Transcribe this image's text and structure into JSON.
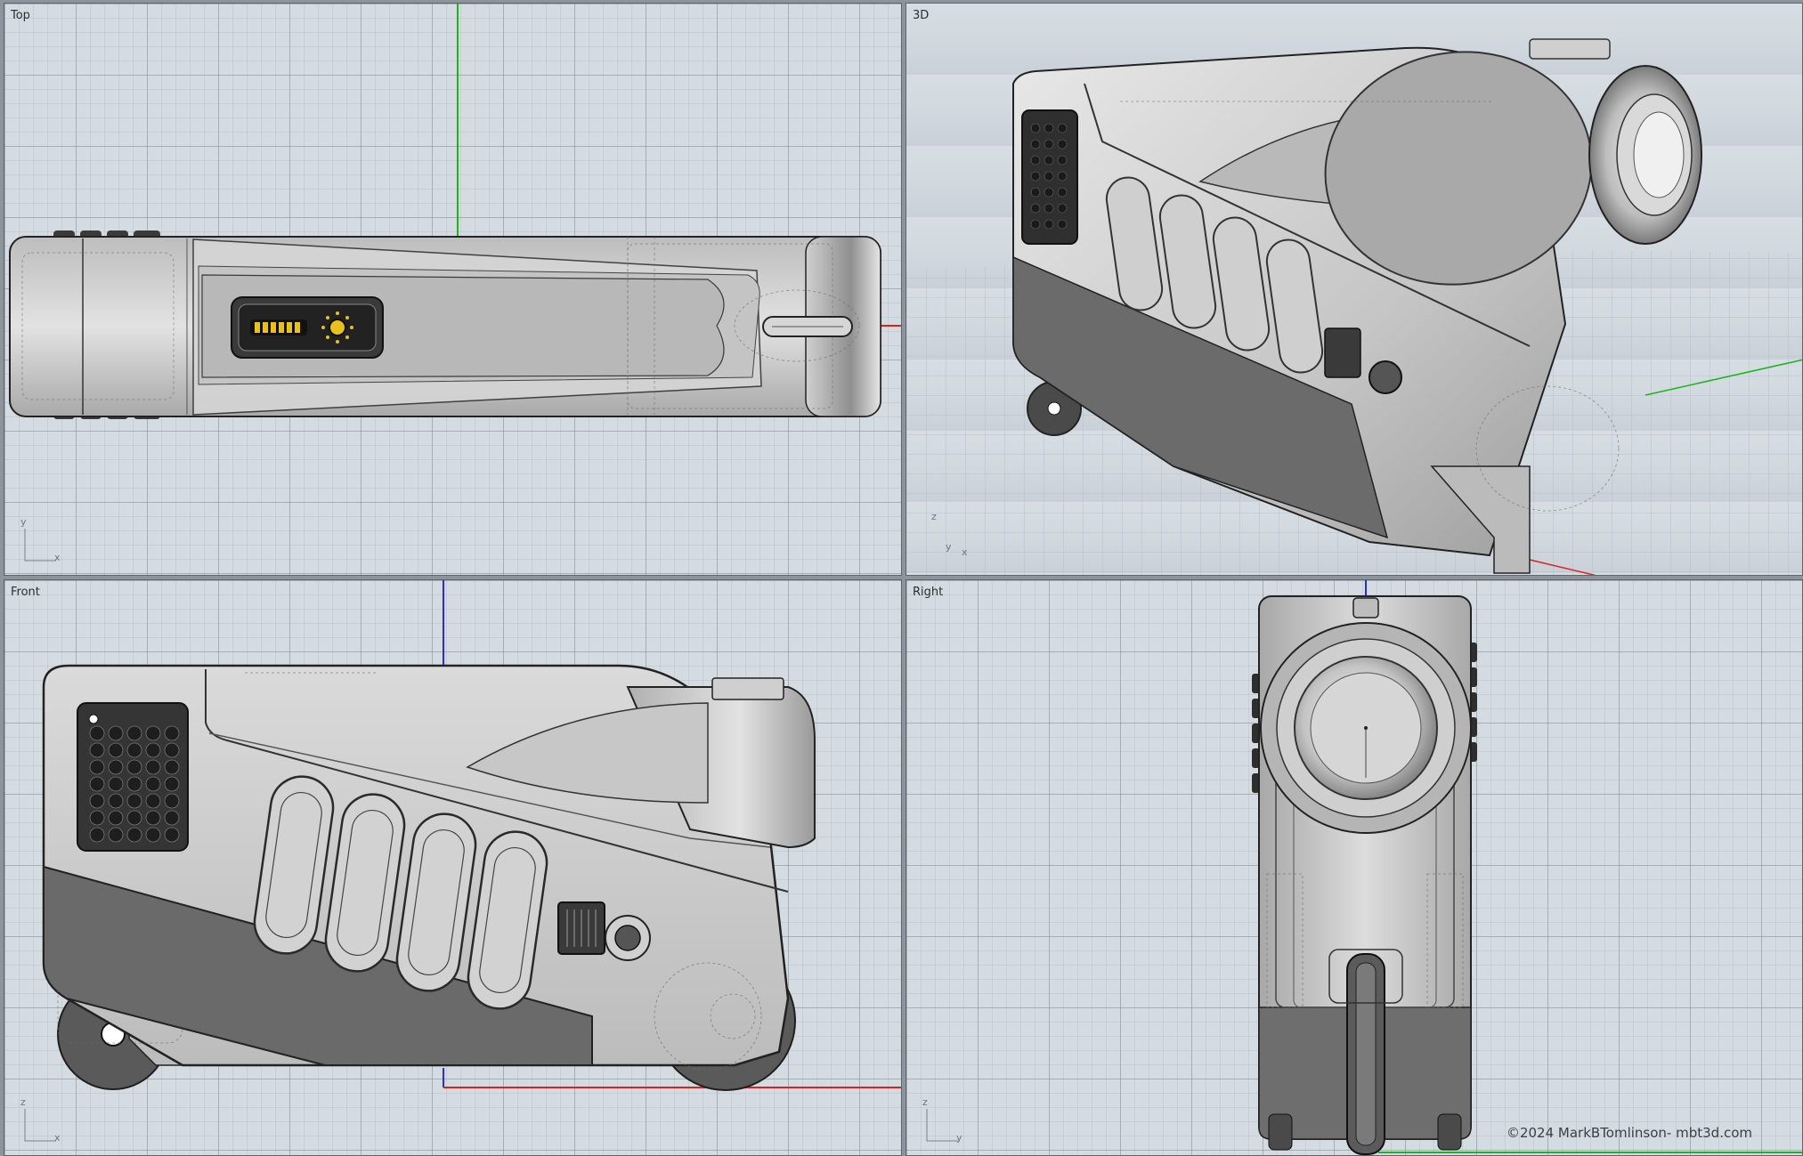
{
  "viewports": {
    "top": {
      "title": "Top",
      "axis_h": "x",
      "axis_v": "y"
    },
    "perspective": {
      "title": "3D",
      "axis_h": "x",
      "axis_v": "z",
      "axis_d": "y"
    },
    "front": {
      "title": "Front",
      "axis_h": "x",
      "axis_v": "z"
    },
    "right": {
      "title": "Right",
      "axis_h": "y",
      "axis_v": "z"
    }
  },
  "copyright": "©2024 MarkBTomlinson- mbt3d.com",
  "colors": {
    "grid_bg": "#d4dbe1",
    "axis_x": "#e02020",
    "axis_y": "#1db31d",
    "axis_z": "#2030e0",
    "body_light": "#c9c9c9",
    "body_dark": "#6e6e6e",
    "accent_contacts": "#e8c21a"
  }
}
